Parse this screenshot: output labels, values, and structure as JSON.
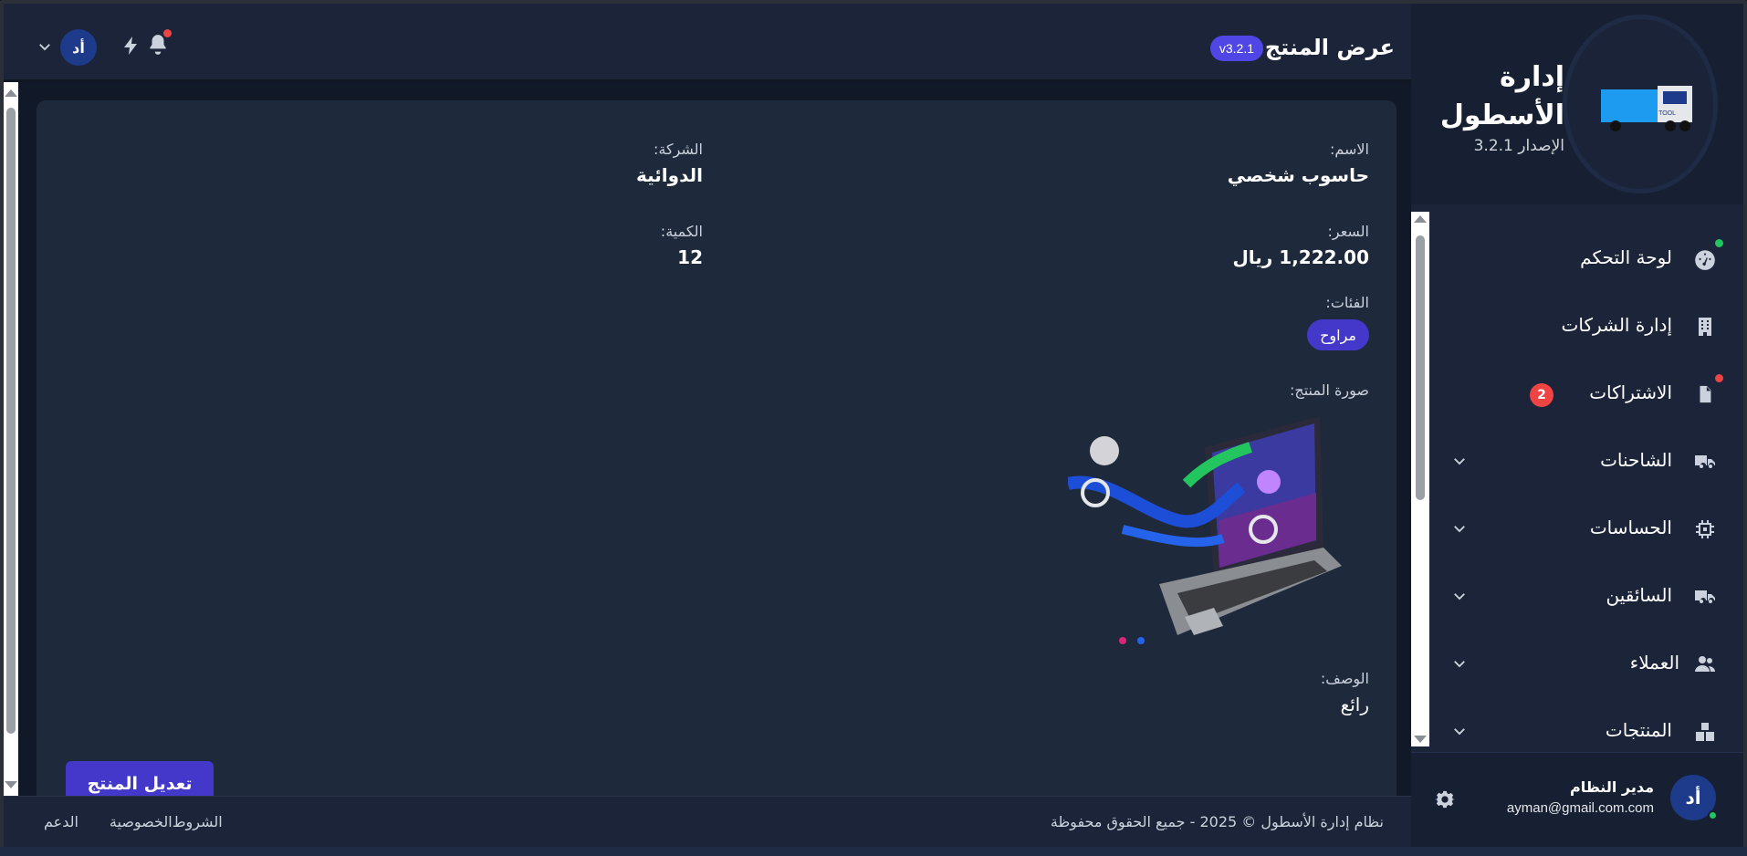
{
  "brand": {
    "title": "إدارة الأسطول",
    "version": "الإصدار 3.2.1"
  },
  "nav": {
    "items": [
      {
        "label": "لوحة التحكم",
        "icon": "dashboard-gauge-icon",
        "status": "green-dot"
      },
      {
        "label": "إدارة الشركات",
        "icon": "building-icon"
      },
      {
        "label": "الاشتراكات",
        "icon": "document-icon",
        "badge": "2",
        "status": "red-dot"
      },
      {
        "label": "الشاحنات",
        "icon": "truck-icon",
        "expandable": true
      },
      {
        "label": "الحساسات",
        "icon": "chip-icon",
        "expandable": true
      },
      {
        "label": "السائقين",
        "icon": "truck-icon",
        "expandable": true
      },
      {
        "label": "العملاء",
        "icon": "users-icon",
        "expandable": true
      },
      {
        "label": "المنتجات",
        "icon": "boxes-icon",
        "expandable": true
      }
    ]
  },
  "user": {
    "initials": "أد",
    "name": "مدير النظام",
    "email": "ayman@gmail.com.com"
  },
  "topbar": {
    "title": "عرض المنتج",
    "version_badge": "v3.2.1",
    "avatar_initials": "أد"
  },
  "product": {
    "name_label": "الاسم:",
    "name_value": "حاسوب شخصي",
    "company_label": "الشركة:",
    "company_value": "الدوائية",
    "price_label": "السعر:",
    "price_value": "1,222.00 ريال",
    "quantity_label": "الكمية:",
    "quantity_value": "12",
    "categories_label": "الفئات:",
    "category_tag": "مراوح",
    "image_label": "صورة المنتج:",
    "description_label": "الوصف:",
    "description_value": "رائع",
    "edit_button": "تعديل المنتج"
  },
  "footer": {
    "copyright": "نظام إدارة الأسطول © 2025 - جميع الحقوق محفوظة",
    "links": [
      "الشروط",
      "الخصوصية",
      "الدعم"
    ]
  },
  "colors": {
    "accent": "#4338ca",
    "badge_red": "#ef4444",
    "online_green": "#22c55e"
  }
}
